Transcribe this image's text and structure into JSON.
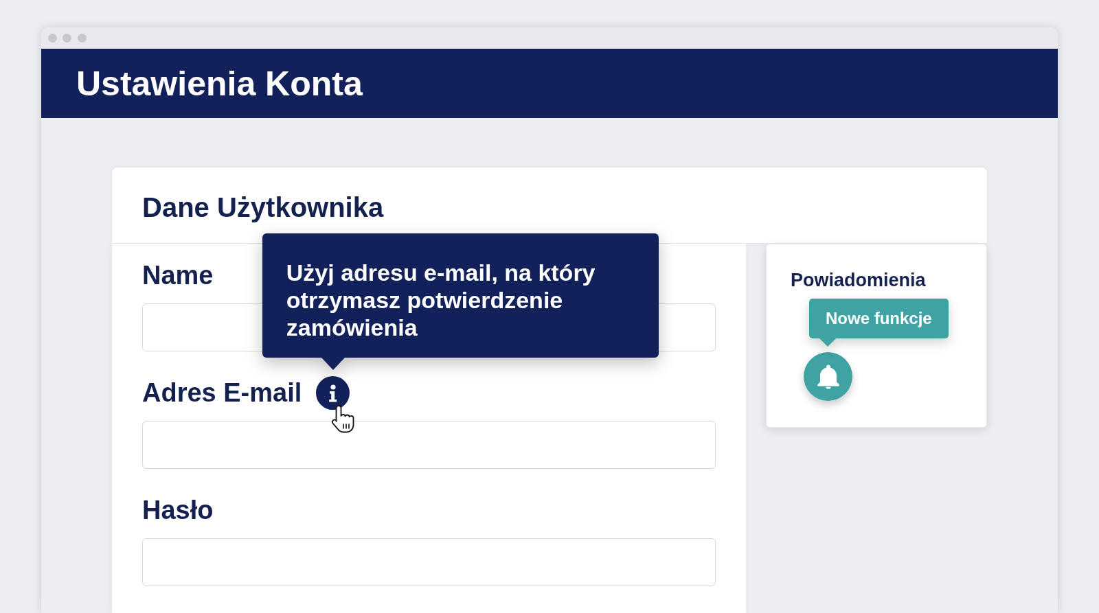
{
  "header": {
    "title": "Ustawienia Konta"
  },
  "user_card": {
    "title": "Dane Użytkownika",
    "fields": [
      {
        "label": "Name",
        "info": false
      },
      {
        "label": "Adres E-mail",
        "info": true,
        "tooltip": "Użyj adresu e-mail, na który otrzymasz potwierdzenie zamówienia"
      },
      {
        "label": "Hasło",
        "info": false
      }
    ]
  },
  "notifications": {
    "title": "Powiadomienia",
    "badge": "Nowe funkcje"
  }
}
